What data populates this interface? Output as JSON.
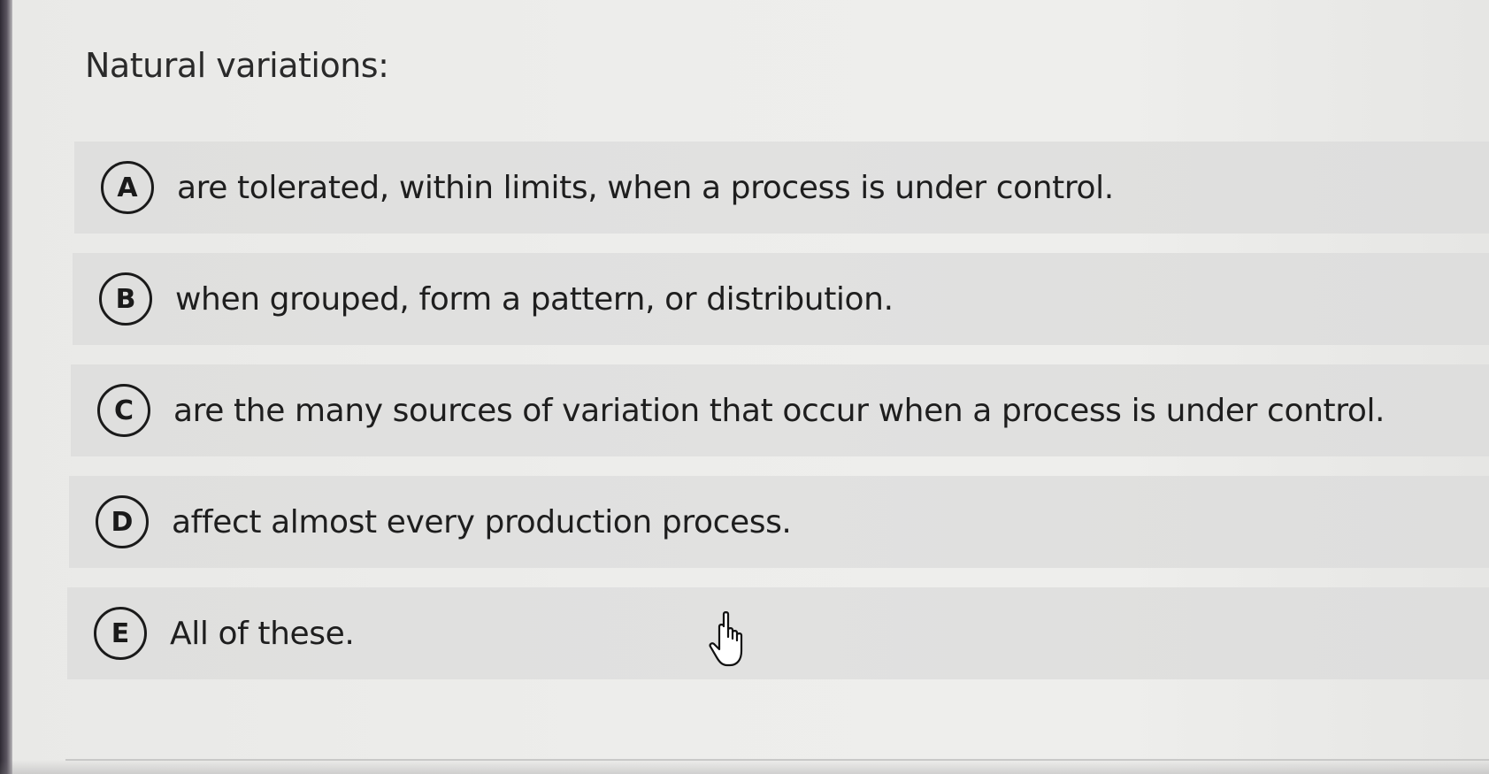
{
  "question": {
    "text": "Natural variations:"
  },
  "options": [
    {
      "letter": "A",
      "text": "are tolerated, within limits, when a process is under control."
    },
    {
      "letter": "B",
      "text": "when grouped, form a pattern, or distribution."
    },
    {
      "letter": "C",
      "text": "are the many sources of variation that occur when a process is under control."
    },
    {
      "letter": "D",
      "text": "affect almost every production process."
    },
    {
      "letter": "E",
      "text": "All of these."
    }
  ],
  "cursor": {
    "icon": "hand-pointer-icon"
  },
  "colors": {
    "background": "#ececea",
    "option_background": "#e0e0df",
    "text": "#1e1e1e"
  }
}
